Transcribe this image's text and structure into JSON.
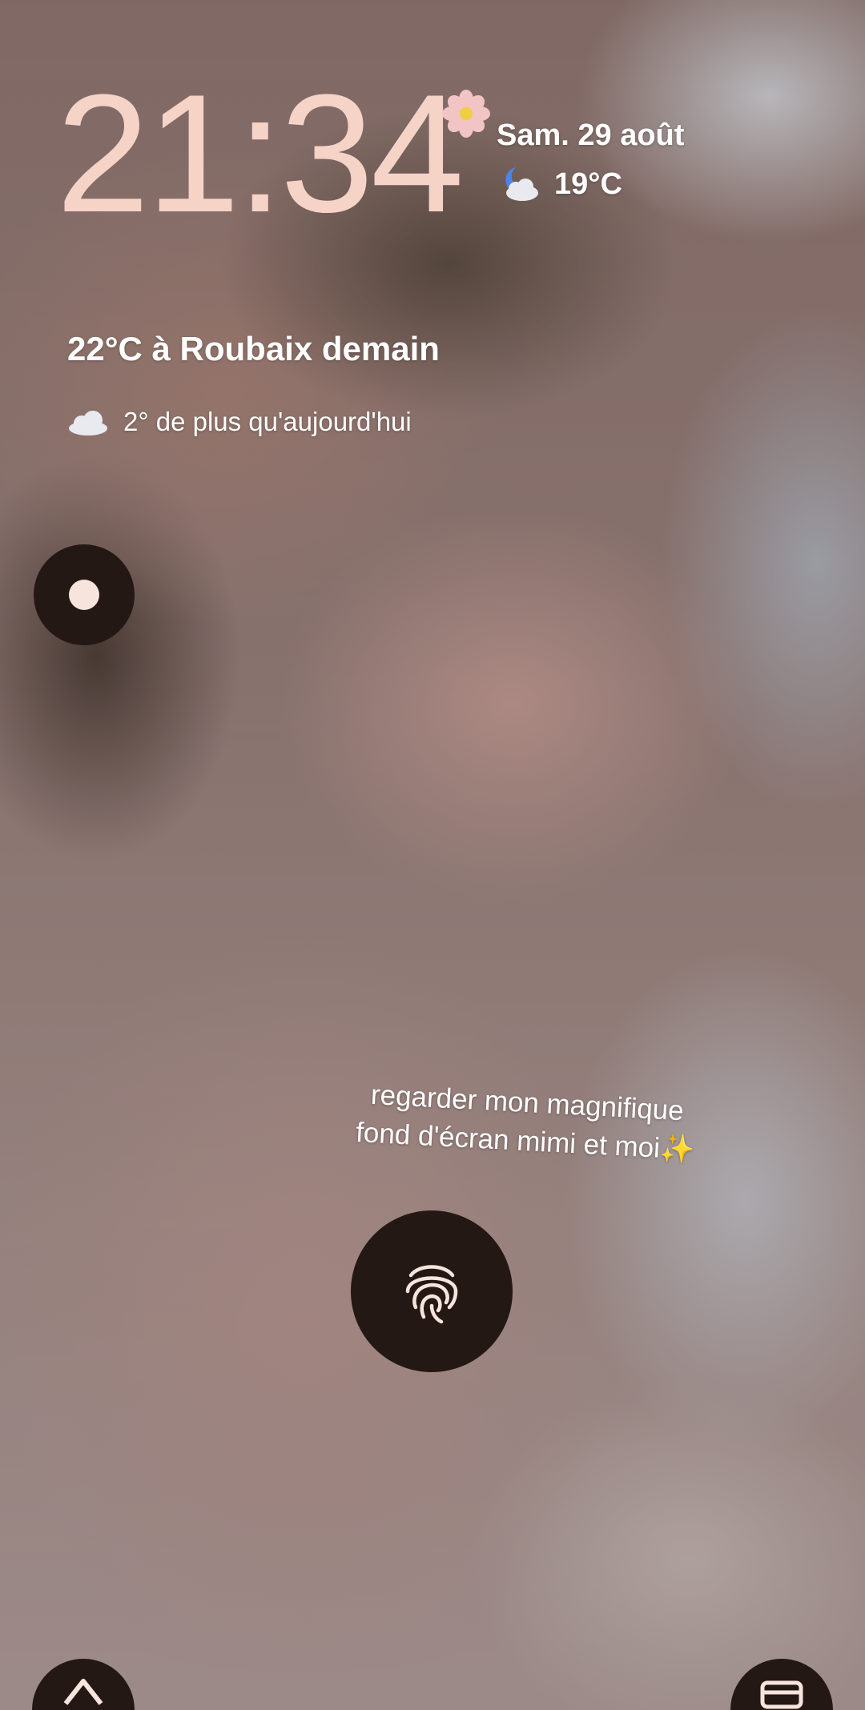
{
  "lockscreen": {
    "clock": "21:34",
    "date": "Sam. 29 août",
    "current_weather": {
      "icon": "partly-cloudy-night-icon",
      "temperature": "19°C"
    },
    "forecast": {
      "title": "22°C à Roubaix demain",
      "icon": "cloud-icon",
      "subtitle": "2° de plus qu'aujourd'hui"
    },
    "caption": {
      "line1": "regarder mon magnifique",
      "line2": "fond d'écran mimi et moi✨"
    }
  },
  "colors": {
    "clock": "#f6d3c7",
    "button_bg": "#241815",
    "button_fg": "#f7e4dd"
  },
  "icons": {
    "shortcut_left": "home-control-icon",
    "shortcut_right": "wallet-icon",
    "fingerprint": "fingerprint-icon",
    "flower": "flower-sticker-icon"
  }
}
